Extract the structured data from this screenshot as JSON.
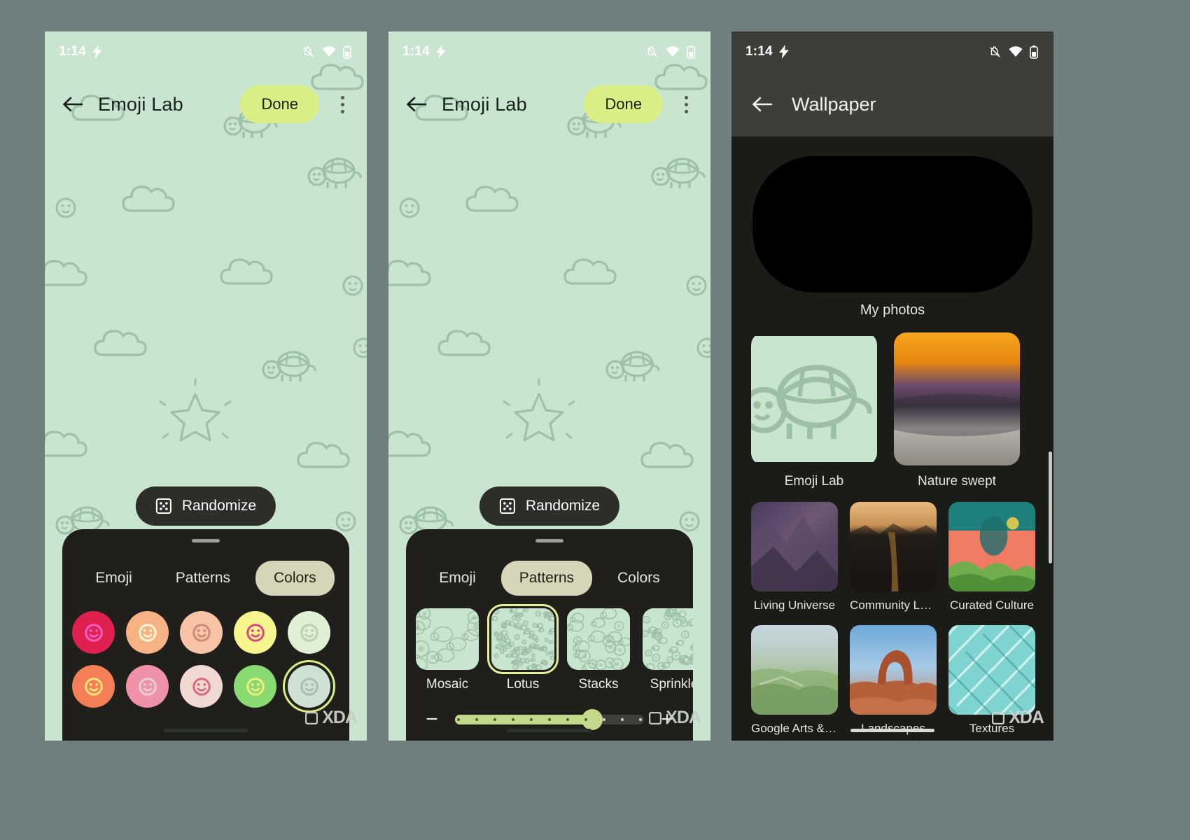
{
  "meta": {
    "watermark": "XDA"
  },
  "phone1": {
    "status": {
      "time": "1:14",
      "icons": [
        "bolt-icon",
        "notifications-off-icon",
        "wifi-icon",
        "battery-icon"
      ]
    },
    "appbar": {
      "back": "back-arrow-icon",
      "title": "Emoji Lab",
      "done_label": "Done",
      "overflow": "more-options-icon"
    },
    "randomize_label": "Randomize",
    "sheet": {
      "tabs": [
        {
          "label": "Emoji",
          "active": false
        },
        {
          "label": "Patterns",
          "active": false
        },
        {
          "label": "Colors",
          "active": true
        }
      ],
      "swatches": [
        {
          "bg": "#e0214f",
          "face": "#f060c8",
          "selected": false
        },
        {
          "bg": "#f6b283",
          "face": "#fdf6d8",
          "selected": false
        },
        {
          "bg": "#f8c4a6",
          "face": "#c98a76",
          "selected": false
        },
        {
          "bg": "#f7f58e",
          "face": "#d4497f",
          "selected": false
        },
        {
          "bg": "#dff0d4",
          "face": "#b9cfae",
          "selected": false
        },
        {
          "bg": "#f47e55",
          "face": "#f6e67a",
          "selected": false
        },
        {
          "bg": "#ef92a8",
          "face": "#e6cfd4",
          "selected": false
        },
        {
          "bg": "#efd9d2",
          "face": "#d9697c",
          "selected": false
        },
        {
          "bg": "#8ada72",
          "face": "#f2f07c",
          "selected": false
        },
        {
          "bg": "#cfe1d3",
          "face": "#a8bfae",
          "selected": true
        }
      ]
    }
  },
  "phone2": {
    "status": {
      "time": "1:14",
      "icons": [
        "bolt-icon",
        "notifications-off-icon",
        "wifi-icon",
        "battery-icon"
      ]
    },
    "appbar": {
      "back": "back-arrow-icon",
      "title": "Emoji Lab",
      "done_label": "Done",
      "overflow": "more-options-icon"
    },
    "randomize_label": "Randomize",
    "sheet": {
      "tabs": [
        {
          "label": "Emoji",
          "active": false
        },
        {
          "label": "Patterns",
          "active": true
        },
        {
          "label": "Colors",
          "active": false
        }
      ],
      "patterns": [
        {
          "label": "Mosaic",
          "selected": false,
          "density": "large"
        },
        {
          "label": "Lotus",
          "selected": true,
          "density": "tiny"
        },
        {
          "label": "Stacks",
          "selected": false,
          "density": "medium"
        },
        {
          "label": "Sprinkle",
          "selected": false,
          "density": "small"
        },
        {
          "label": "",
          "selected": false,
          "density": "medium"
        }
      ],
      "slider": {
        "minus_label": "−",
        "plus_label": "+",
        "value": 8,
        "min": 0,
        "max": 11,
        "ticks": 11
      }
    }
  },
  "phone3": {
    "status": {
      "time": "1:14",
      "icons": [
        "bolt-icon",
        "notifications-off-icon",
        "wifi-icon",
        "battery-icon"
      ]
    },
    "appbar": {
      "back": "back-arrow-icon",
      "title": "Wallpaper"
    },
    "my_photos_label": "My photos",
    "featured": [
      {
        "label": "Emoji Lab",
        "kind": "emoji"
      },
      {
        "label": "Nature swept",
        "kind": "nature"
      }
    ],
    "categories_row1": [
      {
        "label": "Living Universe",
        "kind": "canyon"
      },
      {
        "label": "Community Lens",
        "kind": "waterfall"
      },
      {
        "label": "Curated Culture",
        "kind": "art"
      }
    ],
    "categories_row2": [
      {
        "label": "Google Arts & …",
        "kind": "aerial"
      },
      {
        "label": "Landscapes",
        "kind": "arch"
      },
      {
        "label": "Textures",
        "kind": "texture"
      }
    ],
    "categories_row3": [
      {
        "label": "",
        "kind": "amber"
      },
      {
        "label": "",
        "kind": "dark"
      },
      {
        "label": "",
        "kind": "neon"
      }
    ]
  }
}
